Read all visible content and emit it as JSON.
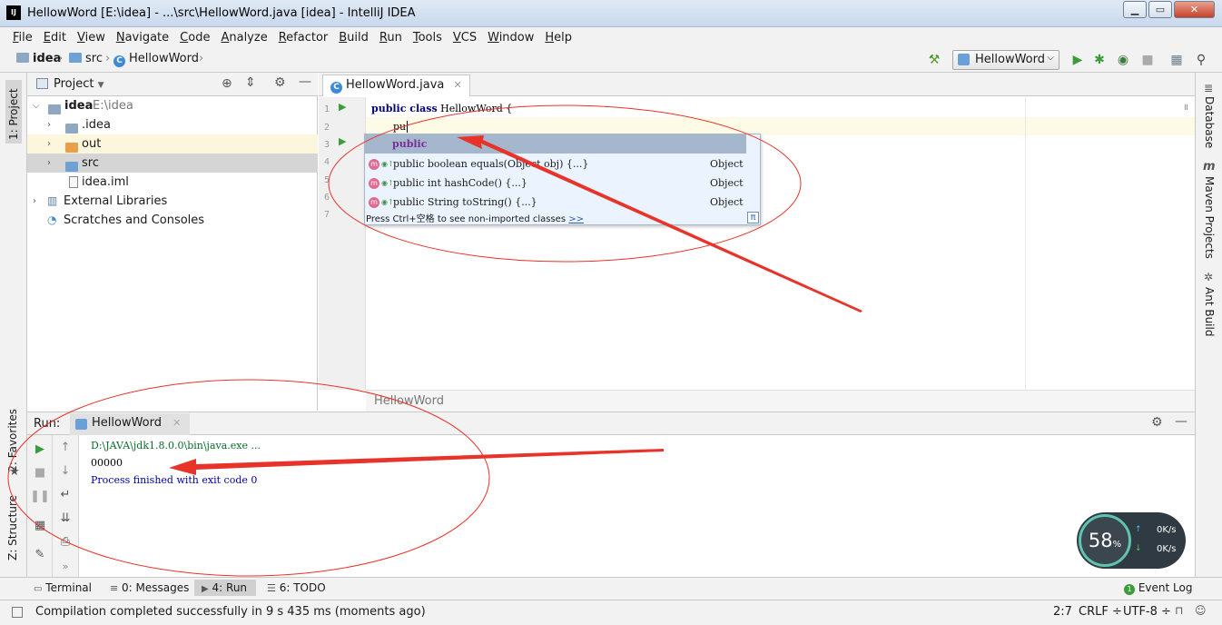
{
  "window": {
    "title": "HellowWord [E:\\idea] - ...\\src\\HellowWord.java [idea] - IntelliJ IDEA",
    "app_icon": "IJ",
    "min": "▁",
    "max": "▭",
    "close": "✕"
  },
  "menu": [
    "File",
    "Edit",
    "View",
    "Navigate",
    "Code",
    "Analyze",
    "Refactor",
    "Build",
    "Run",
    "Tools",
    "VCS",
    "Window",
    "Help"
  ],
  "breadcrumbs": [
    "idea",
    "src",
    "HellowWord"
  ],
  "run_config": "HellowWord",
  "left_stripe": {
    "project": "1: Project",
    "favorites": "2: Favorites",
    "structure": "Z: Structure"
  },
  "right_stripe": [
    "Database",
    "Maven Projects",
    "Ant Build"
  ],
  "project_panel": {
    "title": "Project",
    "tree": [
      {
        "label": "idea",
        "extra": "E:\\idea"
      },
      {
        "label": ".idea"
      },
      {
        "label": "out"
      },
      {
        "label": "src"
      },
      {
        "label": "idea.iml"
      },
      {
        "label": "External Libraries"
      },
      {
        "label": "Scratches and Consoles"
      }
    ]
  },
  "editor": {
    "tab": "HellowWord.java",
    "lines": [
      "1",
      "2",
      "3",
      "4",
      "5",
      "6",
      "7"
    ],
    "code_line1_kw": "public class",
    "code_line1_rest": " HellowWord {",
    "code_line2": "pu",
    "footer": "HellowWord"
  },
  "completion": {
    "selected": "public",
    "items": [
      {
        "text": "public boolean equals(Object obj) {...}",
        "type": "Object"
      },
      {
        "text": "public int hashCode() {...}",
        "type": "Object"
      },
      {
        "text": "public String toString() {...}",
        "type": "Object"
      }
    ],
    "hint": "Press Ctrl+空格 to see non-imported classes",
    "hint_link": ">>",
    "pi": "π"
  },
  "run_panel": {
    "label": "Run:",
    "tab": "HellowWord",
    "console": [
      {
        "text": "D:\\JAVA\\jdk1.8.0.0\\bin\\java.exe ...",
        "color": "#0b6b2a"
      },
      {
        "text": "00000",
        "color": "#000000"
      },
      {
        "text": "Process finished with exit code 0",
        "color": "#0000a0"
      }
    ]
  },
  "bottom_tabs": [
    "Terminal",
    "0: Messages",
    "4: Run",
    "6: TODO"
  ],
  "event_log": "Event Log",
  "status": {
    "message": "Compilation completed successfully in 9 s 435 ms (moments ago)",
    "position": "2:7",
    "line_sep": "CRLF ÷",
    "encoding": "UTF-8 ÷"
  },
  "net_widget": {
    "percent": "58",
    "percent_sign": "%",
    "up": "0K/s",
    "down": "0K/s"
  },
  "colors": {
    "annotation": "#e8332a",
    "accent": "#3d8bd6"
  }
}
